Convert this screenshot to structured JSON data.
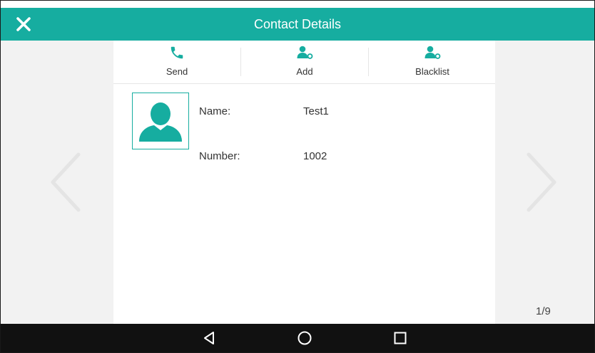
{
  "header": {
    "title": "Contact Details"
  },
  "toolbar": [
    {
      "label": "Send",
      "icon": "phone-icon"
    },
    {
      "label": "Add",
      "icon": "add-contact-icon"
    },
    {
      "label": "Blacklist",
      "icon": "blacklist-contact-icon"
    }
  ],
  "contact": {
    "avatar_icon": "person-silhouette-icon",
    "name_label": "Name:",
    "name_value": "Test1",
    "number_label": "Number:",
    "number_value": "1002"
  },
  "pagination": {
    "text": "1/9"
  },
  "navigation": {
    "prev_icon": "chevron-left-icon",
    "next_icon": "chevron-right-icon"
  },
  "system_bar": {
    "buttons": [
      "back-icon",
      "home-icon",
      "recents-icon"
    ]
  },
  "colors": {
    "accent": "#16ada0",
    "system_bar": "#111111",
    "background": "#f2f2f2"
  }
}
